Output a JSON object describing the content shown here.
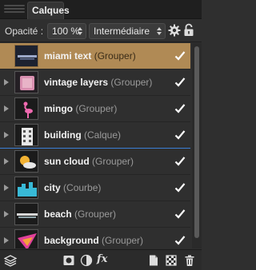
{
  "panel": {
    "tab_label": "Calques"
  },
  "toolbar": {
    "opacity_label": "Opacité :",
    "opacity_value": "100 %",
    "blend_mode": "Intermédiaire"
  },
  "layers": [
    {
      "name": "miami text",
      "type": "(Grouper)",
      "visible": true,
      "selected": true
    },
    {
      "name": "vintage layers",
      "type": "(Grouper)",
      "visible": true,
      "selected": false
    },
    {
      "name": "mingo",
      "type": "(Grouper)",
      "visible": true,
      "selected": false
    },
    {
      "name": "building",
      "type": "(Calque)",
      "visible": true,
      "selected": false
    },
    {
      "name": "sun cloud",
      "type": "(Grouper)",
      "visible": true,
      "selected": false
    },
    {
      "name": "city",
      "type": "(Courbe)",
      "visible": true,
      "selected": false
    },
    {
      "name": "beach",
      "type": "(Grouper)",
      "visible": true,
      "selected": false
    },
    {
      "name": "background",
      "type": "(Grouper)",
      "visible": true,
      "selected": false
    }
  ],
  "bottom_toolbar": {
    "fx_label": "fx"
  },
  "colors": {
    "selection": "#b08a55",
    "panel_bg": "#2f2f2f",
    "active_line": "#3b7fd6"
  }
}
